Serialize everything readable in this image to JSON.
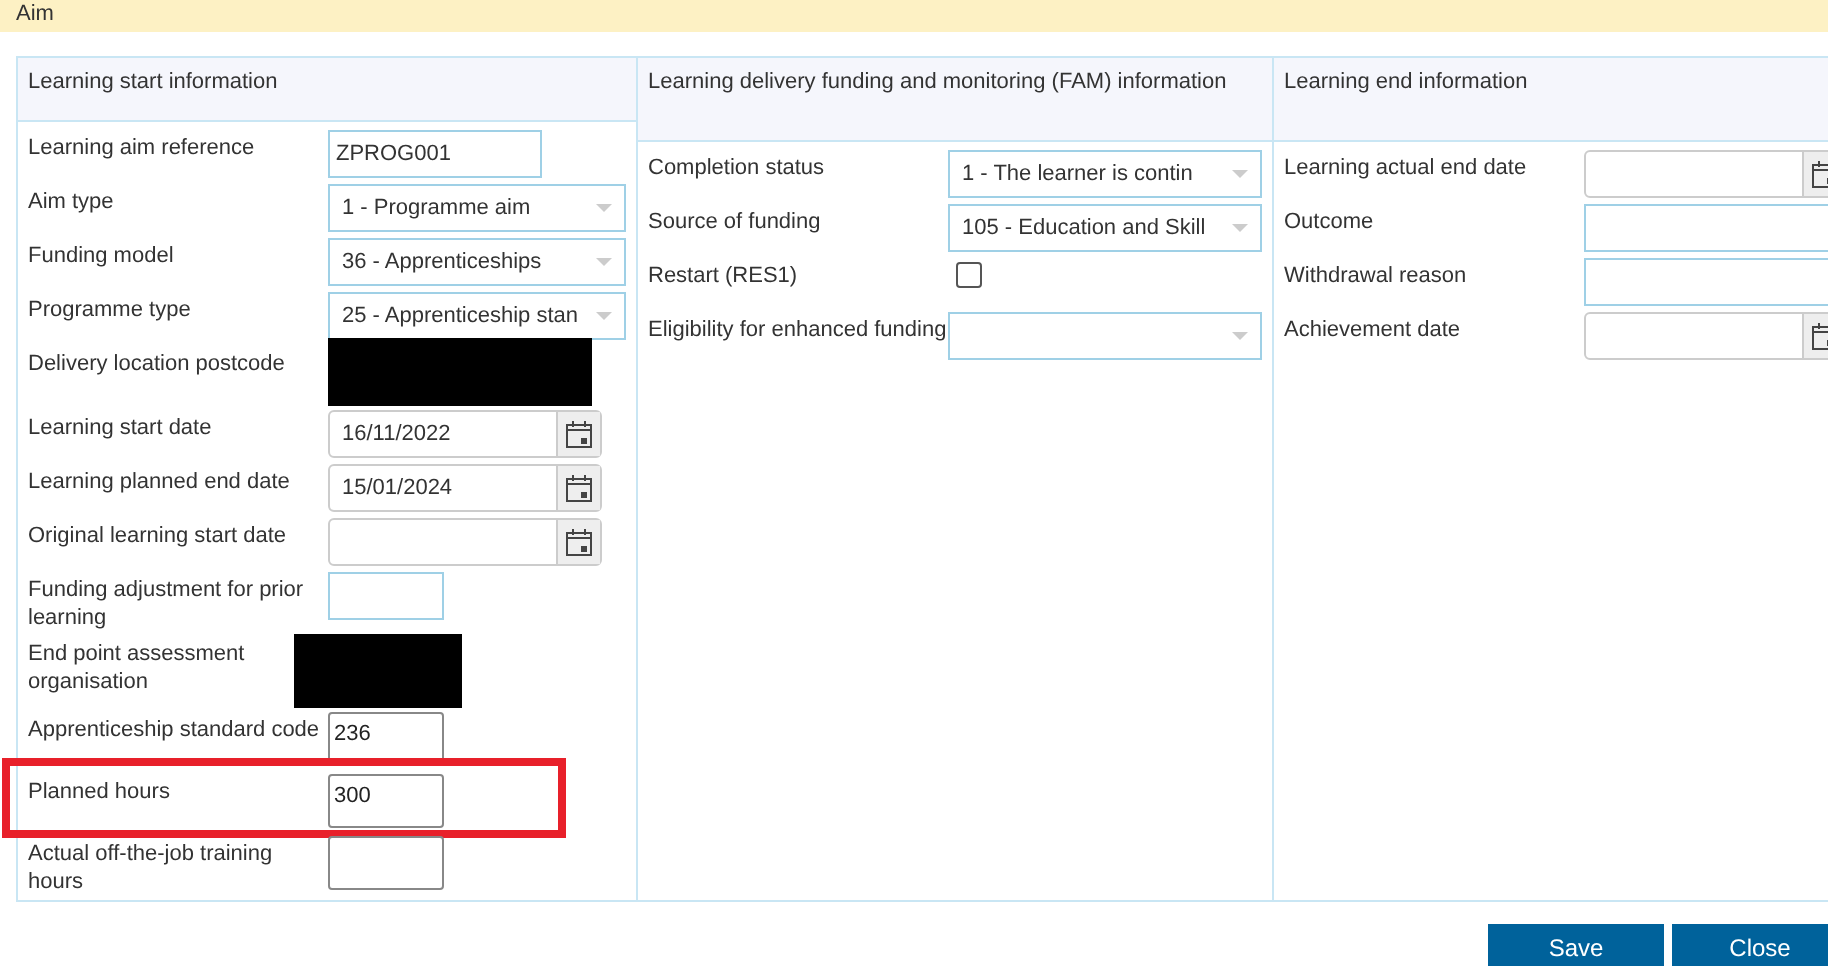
{
  "banner": {
    "title": "Aim"
  },
  "sections": [
    {
      "title": "Learning start information",
      "fields": [
        {
          "label": "Learning aim reference",
          "kind": "text",
          "value": "ZPROG001",
          "highlighted": false
        },
        {
          "label": "Aim type",
          "kind": "select",
          "value": "1 - Programme aim",
          "highlighted": false
        },
        {
          "label": "Funding model",
          "kind": "select",
          "value": "36 - Apprenticeships",
          "highlighted": false
        },
        {
          "label": "Programme type",
          "kind": "select",
          "value": "25 - Apprenticeship stan",
          "highlighted": false
        },
        {
          "label": "Delivery location postcode",
          "kind": "redacted",
          "highlighted": false
        },
        {
          "label": "Learning start date",
          "kind": "date",
          "value": "16/11/2022",
          "highlighted": false
        },
        {
          "label": "Learning planned end date",
          "kind": "date",
          "value": "15/01/2024",
          "highlighted": false
        },
        {
          "label": "Original learning start date",
          "kind": "date",
          "highlighted": false
        },
        {
          "label": "Funding adjustment for prior learning",
          "kind": "short",
          "highlighted": false
        },
        {
          "label": "End point assessment organisation",
          "kind": "redacted",
          "highlighted": false
        },
        {
          "label": "Apprenticeship standard code",
          "kind": "short",
          "value": "236",
          "highlighted": false
        },
        {
          "label": "Planned hours",
          "kind": "short",
          "value": "300",
          "highlighted": true
        },
        {
          "label": "Actual off-the-job training hours",
          "kind": "short",
          "highlighted": false
        }
      ]
    },
    {
      "title": "Learning delivery funding and monitoring (FAM) information",
      "fields": [
        {
          "label": "Completion status",
          "kind": "select",
          "value": "1 - The learner is contin",
          "highlighted": false
        },
        {
          "label": "Source of funding",
          "kind": "select",
          "value": "105 - Education and Skill",
          "highlighted": false
        },
        {
          "label": "Restart (RES1)",
          "kind": "checkbox",
          "checked": false,
          "highlighted": false
        },
        {
          "label": "Eligibility for enhanced funding",
          "kind": "select",
          "highlighted": false
        }
      ]
    },
    {
      "title": "Learning end information",
      "fields": [
        {
          "label": "Learning actual end date",
          "kind": "date",
          "highlighted": false
        },
        {
          "label": "Outcome",
          "kind": "text",
          "highlighted": false
        },
        {
          "label": "Withdrawal reason",
          "kind": "text",
          "highlighted": false
        },
        {
          "label": "Achievement date",
          "kind": "date",
          "highlighted": false
        }
      ]
    }
  ],
  "buttons": [
    "Save",
    "Close"
  ]
}
